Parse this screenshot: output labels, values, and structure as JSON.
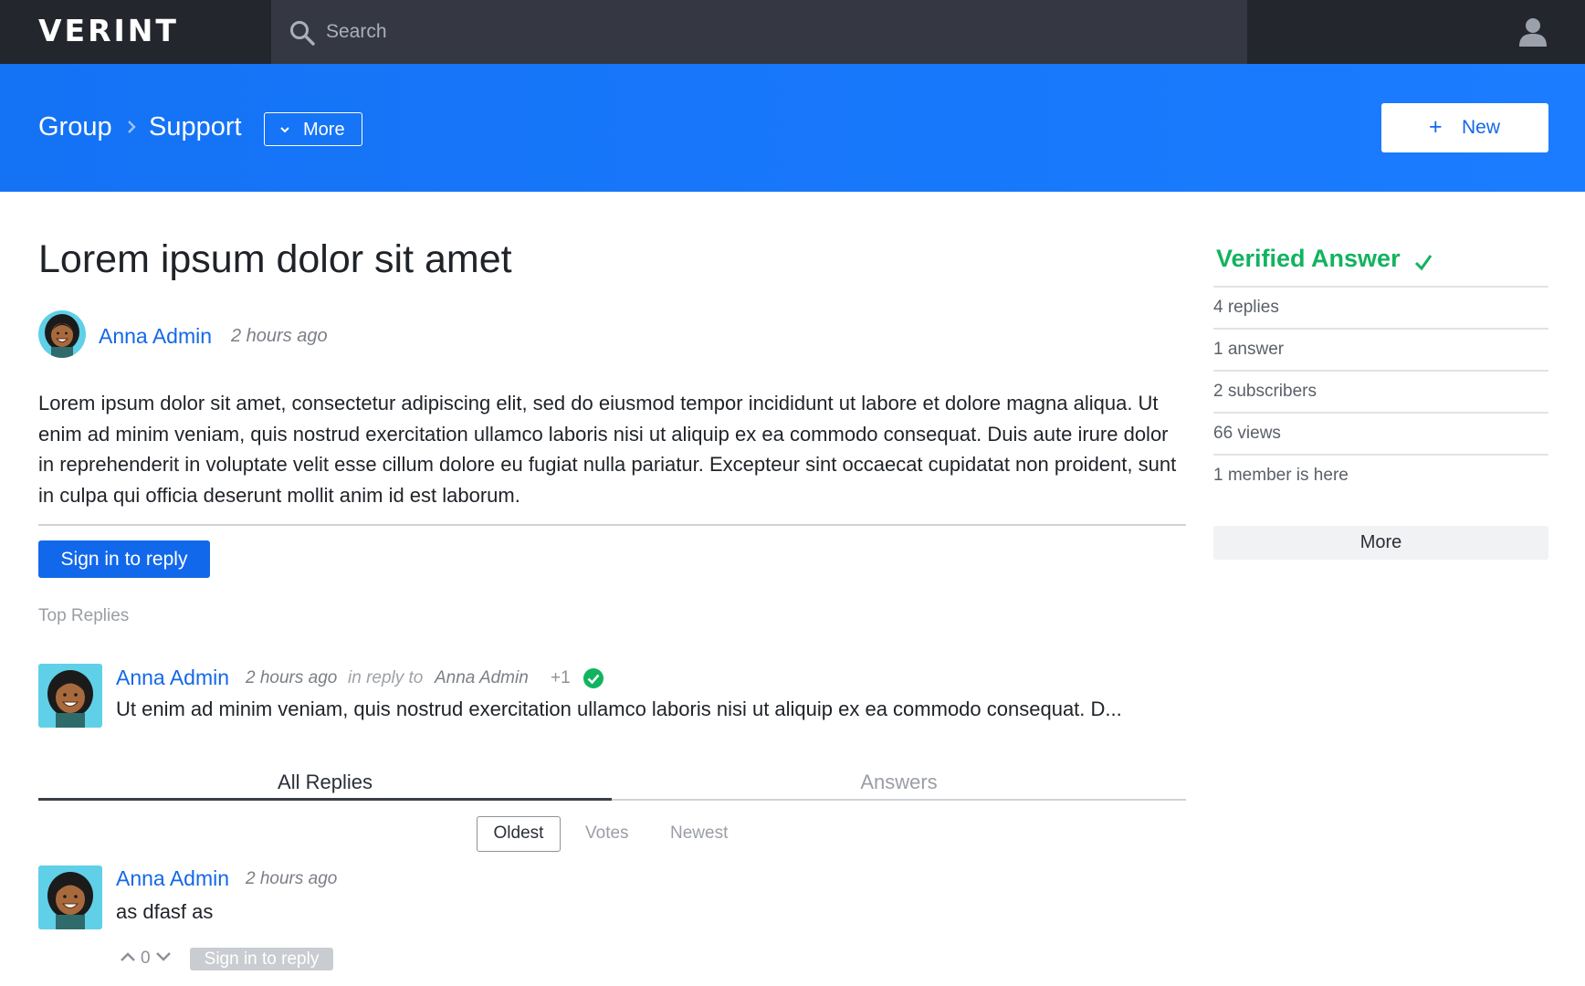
{
  "topbar": {
    "logo": "VERINT",
    "search_placeholder": "Search"
  },
  "header": {
    "breadcrumb": [
      "Group",
      "Support"
    ],
    "more_label": "More",
    "new_label": "New"
  },
  "post": {
    "title": "Lorem ipsum dolor sit amet",
    "author": "Anna Admin",
    "time": "2 hours ago",
    "body": "Lorem ipsum dolor sit amet, consectetur adipiscing elit, sed do eiusmod tempor incididunt ut labore et dolore magna aliqua. Ut enim ad minim veniam, quis nostrud exercitation ullamco laboris nisi ut aliquip ex ea commodo consequat. Duis aute irure dolor in reprehenderit in voluptate velit esse cillum dolore eu fugiat nulla pariatur. Excepteur sint occaecat cupidatat non proident, sunt in culpa qui officia deserunt mollit anim id est laborum.",
    "sign_in_label": "Sign in to reply"
  },
  "top_replies": {
    "section_label": "Top Replies",
    "items": [
      {
        "author": "Anna Admin",
        "time": "2 hours ago",
        "in_reply_prefix": "in reply to",
        "in_reply_to": "Anna Admin",
        "votes": "+1",
        "text": "Ut enim ad minim veniam, quis nostrud exercitation ullamco laboris nisi ut aliquip ex ea commodo consequat. D..."
      }
    ]
  },
  "tabs": [
    "All Replies",
    "Answers"
  ],
  "sort": [
    "Oldest",
    "Votes",
    "Newest"
  ],
  "replies": [
    {
      "author": "Anna Admin",
      "time": "2 hours ago",
      "text": "as dfasf as",
      "vote_count": "0",
      "sign_in_label": "Sign in to reply"
    }
  ],
  "sidebar": {
    "verified_label": "Verified Answer",
    "stats": [
      "4 replies",
      "1 answer",
      "2 subscribers",
      "66 views",
      "1 member is here"
    ],
    "more_label": "More"
  },
  "colors": {
    "brand_blue": "#1b7cff",
    "link_blue": "#1468e8",
    "verified_green": "#12b35f",
    "topbar": "#24262d"
  }
}
